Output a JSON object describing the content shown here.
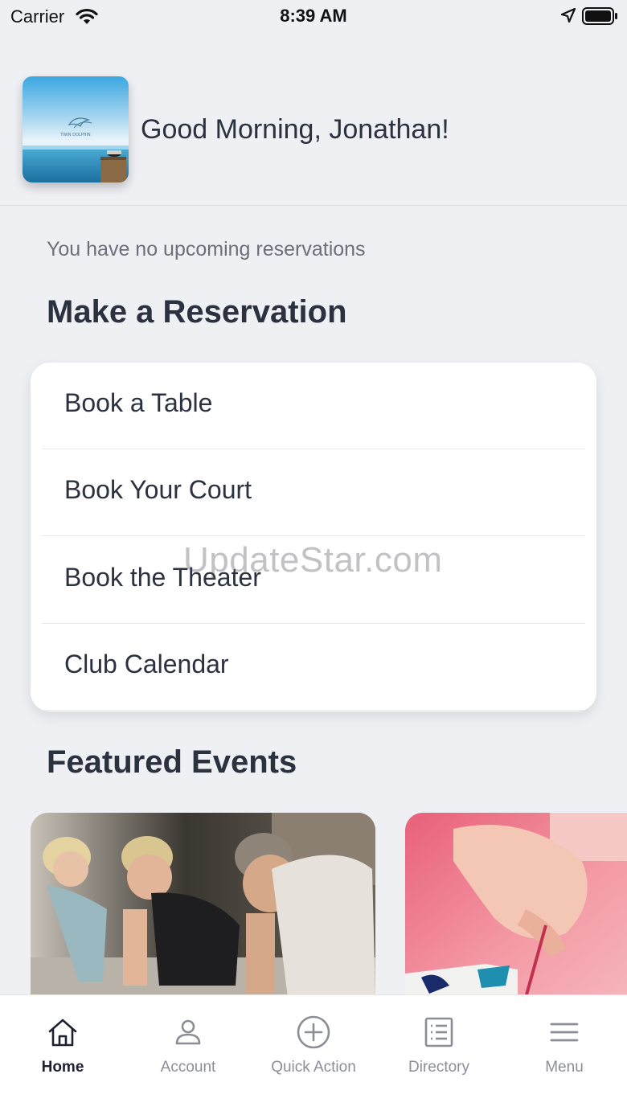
{
  "status_bar": {
    "carrier": "Carrier",
    "time": "8:39 AM",
    "icons": [
      "wifi-icon",
      "location-arrow-icon",
      "battery-icon"
    ]
  },
  "header": {
    "logo_text": "TWIN DOLPHIN",
    "greeting": "Good Morning, Jonathan!"
  },
  "reservations": {
    "empty_text": "You have no upcoming reservations",
    "title": "Make a Reservation",
    "items": [
      {
        "label": "Book a Table"
      },
      {
        "label": "Book Your Court"
      },
      {
        "label": "Book the Theater"
      },
      {
        "label": "Club Calendar"
      }
    ]
  },
  "watermark": "UpdateStar.com",
  "featured": {
    "title": "Featured Events",
    "events": [
      {
        "image": "fitness-class-photo"
      },
      {
        "image": "painting-class-photo"
      }
    ]
  },
  "tabbar": {
    "tabs": [
      {
        "label": "Home",
        "icon": "home-icon",
        "active": true
      },
      {
        "label": "Account",
        "icon": "person-icon",
        "active": false
      },
      {
        "label": "Quick Action",
        "icon": "plus-circle-icon",
        "active": false
      },
      {
        "label": "Directory",
        "icon": "list-document-icon",
        "active": false
      },
      {
        "label": "Menu",
        "icon": "hamburger-menu-icon",
        "active": false
      }
    ]
  },
  "colors": {
    "background": "#eff0f4",
    "text_primary": "#2c3140",
    "text_secondary": "#6b6f7a",
    "tab_inactive": "#8b8e97",
    "tab_active": "#1d2130"
  }
}
